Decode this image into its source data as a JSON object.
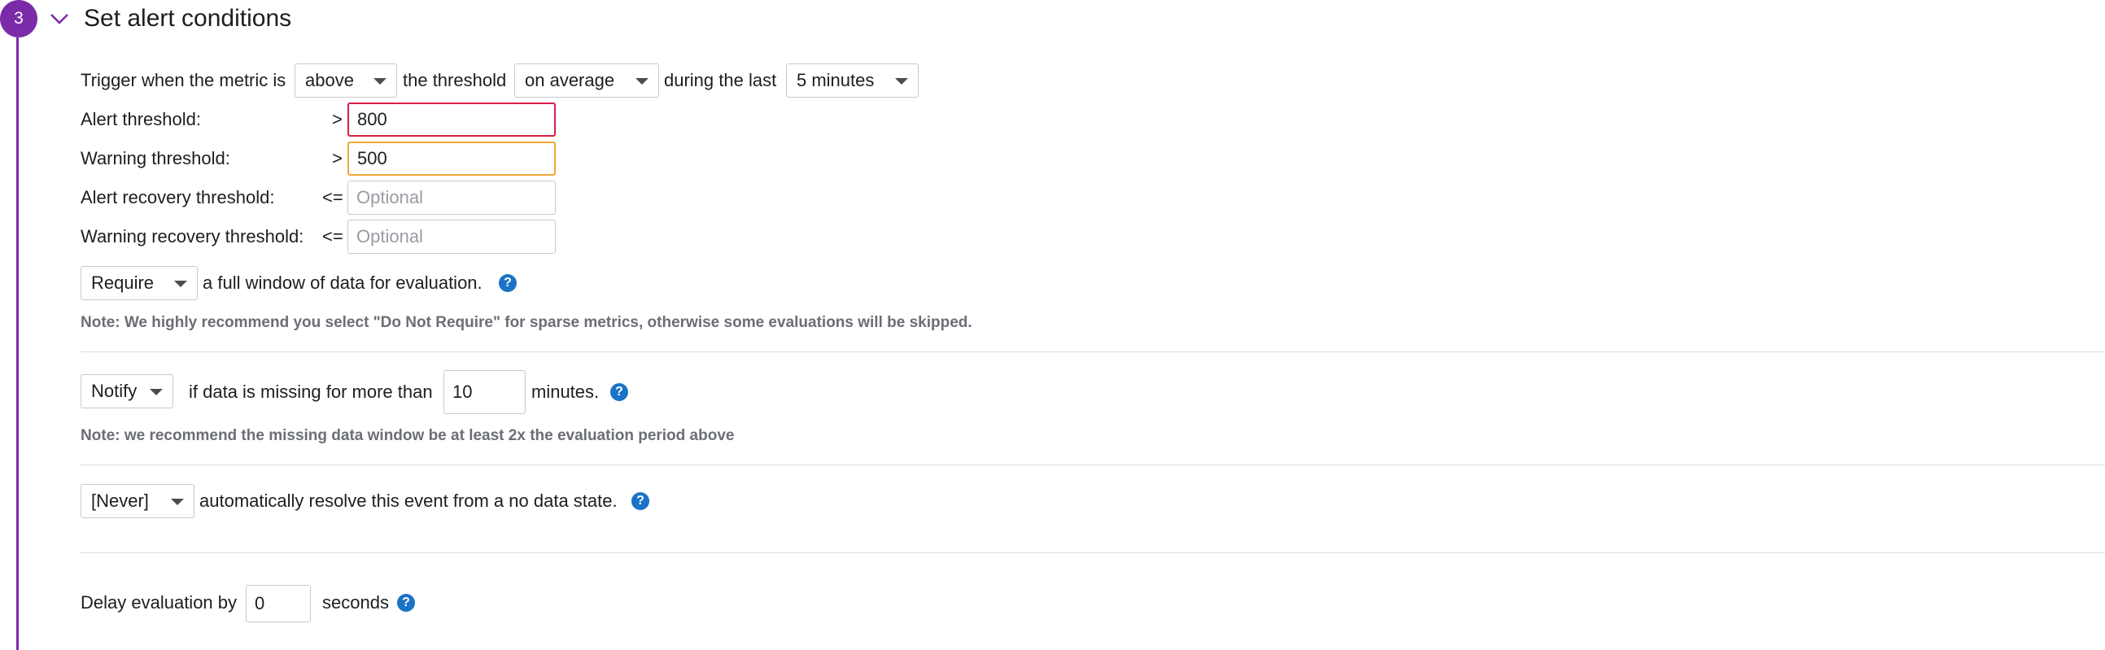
{
  "section": {
    "step_number": "3",
    "title": "Set alert conditions"
  },
  "trigger": {
    "prefix": "Trigger when the metric is",
    "comparison": "above",
    "mid": "the threshold",
    "aggregation": "on average",
    "during": "during the last",
    "window": "5 minutes"
  },
  "thresholds": {
    "alert_label": "Alert threshold:",
    "alert_op": ">",
    "alert_value": "800",
    "warning_label": "Warning threshold:",
    "warning_op": ">",
    "warning_value": "500",
    "alert_recovery_label": "Alert recovery threshold:",
    "alert_recovery_op": "<=",
    "alert_recovery_placeholder": "Optional",
    "warning_recovery_label": "Warning recovery threshold:",
    "warning_recovery_op": "<=",
    "warning_recovery_placeholder": "Optional"
  },
  "full_window": {
    "select": "Require",
    "text": "a full window of data for evaluation.",
    "note": "Note: We highly recommend you select \"Do Not Require\" for sparse metrics, otherwise some evaluations will be skipped."
  },
  "missing_data": {
    "select": "Notify",
    "text": "if data is missing for more than",
    "value": "10",
    "unit": "minutes.",
    "note": "Note: we recommend the missing data window be at least 2x the evaluation period above"
  },
  "auto_resolve": {
    "select": "[Never]",
    "text": "automatically resolve this event from a no data state."
  },
  "delay": {
    "label": "Delay evaluation by",
    "value": "0",
    "unit": "seconds"
  },
  "help_glyph": "?",
  "colors": {
    "accent_purple": "#7b2aa8",
    "alert_border": "#d6204a",
    "warning_border": "#f1a83a",
    "help_blue": "#1a73c6"
  }
}
